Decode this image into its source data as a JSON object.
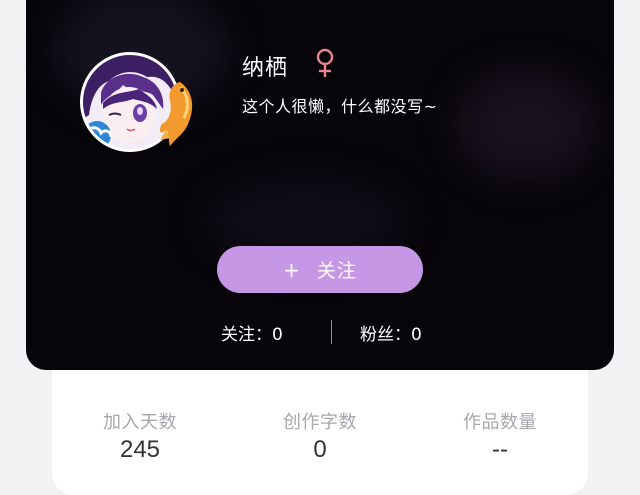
{
  "profile": {
    "name": "纳栖",
    "gender_symbol": "♀",
    "gender_color": "#e8858f",
    "bio": "这个人很懒，什么都没写~",
    "avatar_icon": "avatar-anime-girl",
    "avatar_badge_icon": "koi-fish-icon"
  },
  "follow_button": {
    "plus": "+",
    "label": "关注",
    "color": "#c597e4"
  },
  "social": {
    "following": "关注：0",
    "fans": "粉丝：0"
  },
  "stats": [
    {
      "label": "加入天数",
      "value": "245"
    },
    {
      "label": "创作字数",
      "value": "0"
    },
    {
      "label": "作品数量",
      "value": "--"
    }
  ],
  "colors": {
    "header_bg": "#07050a",
    "panel_bg": "#ffffff",
    "page_bg": "#f2f2f4"
  }
}
